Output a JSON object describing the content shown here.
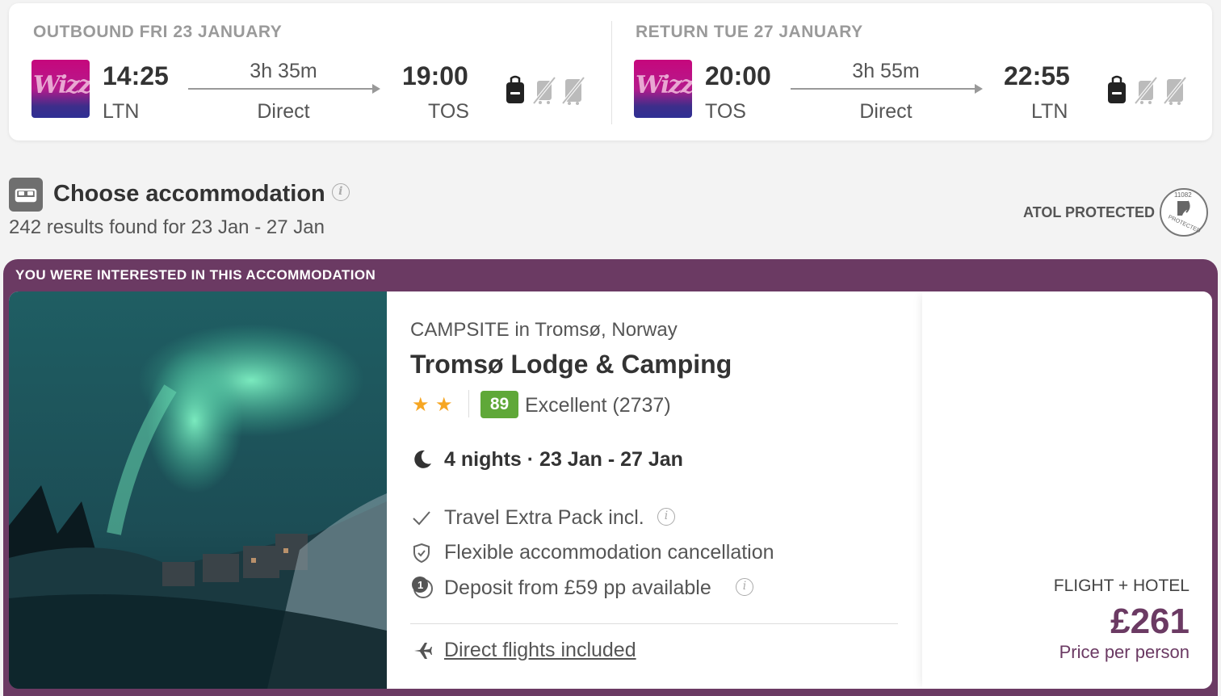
{
  "outbound": {
    "title": "OUTBOUND FRI 23 JANUARY",
    "airline_logo_text": "Wizz",
    "depart_time": "14:25",
    "depart_code": "LTN",
    "duration": "3h 35m",
    "stops": "Direct",
    "arrive_time": "19:00",
    "arrive_code": "TOS",
    "baggage_icons": [
      "personal-bag-icon",
      "no-cabin-bag-icon",
      "no-checked-bag-icon"
    ]
  },
  "return": {
    "title": "RETURN TUE 27 JANUARY",
    "airline_logo_text": "Wizz",
    "depart_time": "20:00",
    "depart_code": "TOS",
    "duration": "3h 55m",
    "stops": "Direct",
    "arrive_time": "22:55",
    "arrive_code": "LTN",
    "baggage_icons": [
      "personal-bag-icon",
      "no-cabin-bag-icon",
      "no-checked-bag-icon"
    ]
  },
  "accommodation_header": {
    "title": "Choose accommodation",
    "results": "242 results found for 23 Jan - 27 Jan",
    "atol_label": "ATOL PROTECTED"
  },
  "featured": {
    "label": "YOU WERE INTERESTED IN THIS ACCOMMODATION",
    "hotel": {
      "type": "CAMPSITE in Tromsø, Norway",
      "name": "Tromsø Lodge & Camping",
      "stars": 2,
      "score": "89",
      "score_text": "Excellent (2737)",
      "nights": "4 nights · 23 Jan - 27 Jan",
      "features": [
        {
          "icon": "check-icon",
          "text": "Travel Extra Pack incl."
        },
        {
          "icon": "shield-check-icon",
          "text": "Flexible accommodation cancellation"
        },
        {
          "icon": "coins-icon",
          "text": "Deposit from £59 pp available"
        }
      ],
      "flights_link": "Direct flights included"
    },
    "price": {
      "type": "FLIGHT + HOTEL",
      "amount": "£261",
      "per": "Price per person"
    }
  },
  "colors": {
    "brand_purple": "#6b3a63",
    "score_green": "#5fa838",
    "star_orange": "#f6a623"
  }
}
